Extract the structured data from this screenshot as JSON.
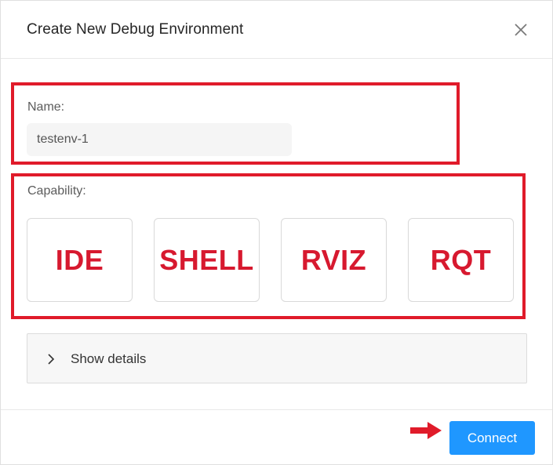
{
  "dialog": {
    "title": "Create New Debug Environment",
    "close_icon": "close-icon"
  },
  "name_field": {
    "label": "Name:",
    "value": "testenv-1"
  },
  "capability": {
    "label": "Capability:",
    "options": [
      "IDE",
      "SHELL",
      "RVIZ",
      "RQT"
    ]
  },
  "details": {
    "label": "Show details",
    "icon": "chevron-right-icon"
  },
  "footer": {
    "connect_label": "Connect"
  },
  "colors": {
    "annotation_red": "#e01b2a",
    "capability_text": "#d7192f",
    "primary_button": "#1f97ff"
  }
}
